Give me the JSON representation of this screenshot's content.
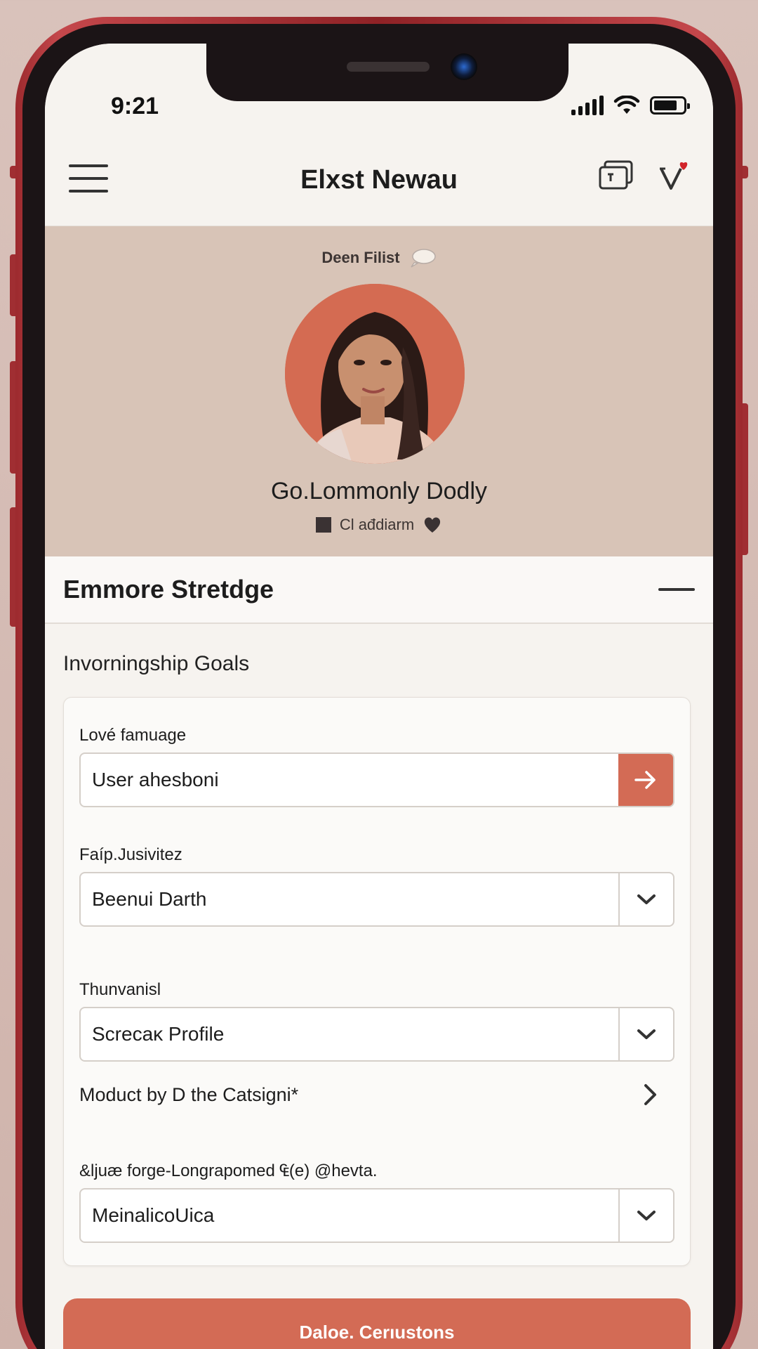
{
  "status_bar": {
    "time": "9:21"
  },
  "header": {
    "title": "Elxst Newau",
    "menu_icon": "hamburger-icon",
    "cards_icon": "cards-icon",
    "logo_icon": "heart-v-logo-icon"
  },
  "profile": {
    "badge_text": "Deen Filist",
    "name": "Go.Lommonly Dodly",
    "meta_text": "Cl ađdiarm",
    "avatar_bg": "#d46b52"
  },
  "section": {
    "title": "Emmore Stretdge"
  },
  "goals": {
    "title": "Invorningship Goals",
    "fields": [
      {
        "label": "Lové famuage",
        "value": "User ahesboni",
        "control": "arrow-right-icon"
      },
      {
        "label": "Faíp.Jusivitez",
        "value": "Beenui Darth",
        "control": "chevron-down-icon"
      },
      {
        "label": "Thunvanisl",
        "value": "Screcaĸ Profile",
        "control": "chevron-down-icon"
      }
    ],
    "link": {
      "label": "Moduct by D the Catsigni*",
      "control": "chevron-right-icon"
    },
    "last_field": {
      "label": "&ljuæ forge-Longrapomed ₠(e) @hevta.",
      "value": "MeinalicoUica",
      "control": "chevron-down-icon"
    }
  },
  "primary_button": {
    "label": "Daloe. Cerıustons"
  },
  "colors": {
    "accent": "#d36b55",
    "hero_bg": "#d8c4b7",
    "frame": "#9c2a2e"
  }
}
